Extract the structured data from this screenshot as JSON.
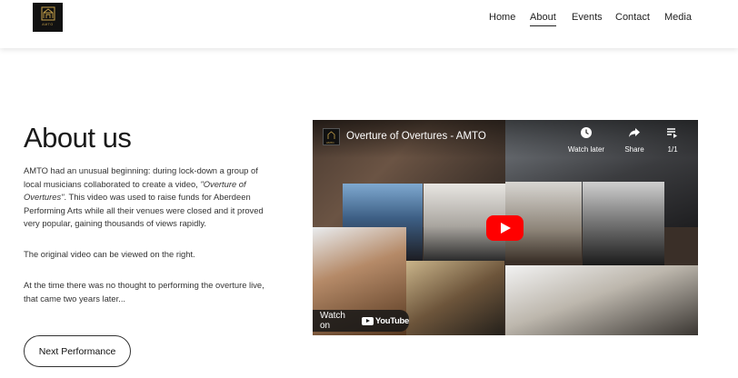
{
  "header": {
    "logo_text": "AMTO",
    "nav": [
      {
        "label": "Home"
      },
      {
        "label": "About"
      },
      {
        "label": "Events"
      },
      {
        "label": "Contact"
      },
      {
        "label": "Media"
      }
    ]
  },
  "about": {
    "title": "About us",
    "p1_a": "AMTO had an unusual beginning:  during lock-down a group of local musicians collaborated to create a video, ",
    "p1_em": "\"Overture of Overtures\"",
    "p1_b": ". This video was used to raise funds for Aberdeen Performing Arts while all their venues were closed and it proved very popular, gaining thousands of views rapidly.",
    "p2": "The original video can be viewed on the right.",
    "p3": "At the time there was no thought to performing the overture live, that came two years later...",
    "button": "Next Performance"
  },
  "video": {
    "logo_text": "AMTO",
    "title": "Overture of Overtures - AMTO",
    "watch_later": "Watch later",
    "share": "Share",
    "counter": "1/1",
    "watch_on": "Watch on",
    "youtube": "YouTube"
  },
  "colors": {
    "play_red": "#ff0000",
    "logo_gold": "#c9a34a"
  }
}
